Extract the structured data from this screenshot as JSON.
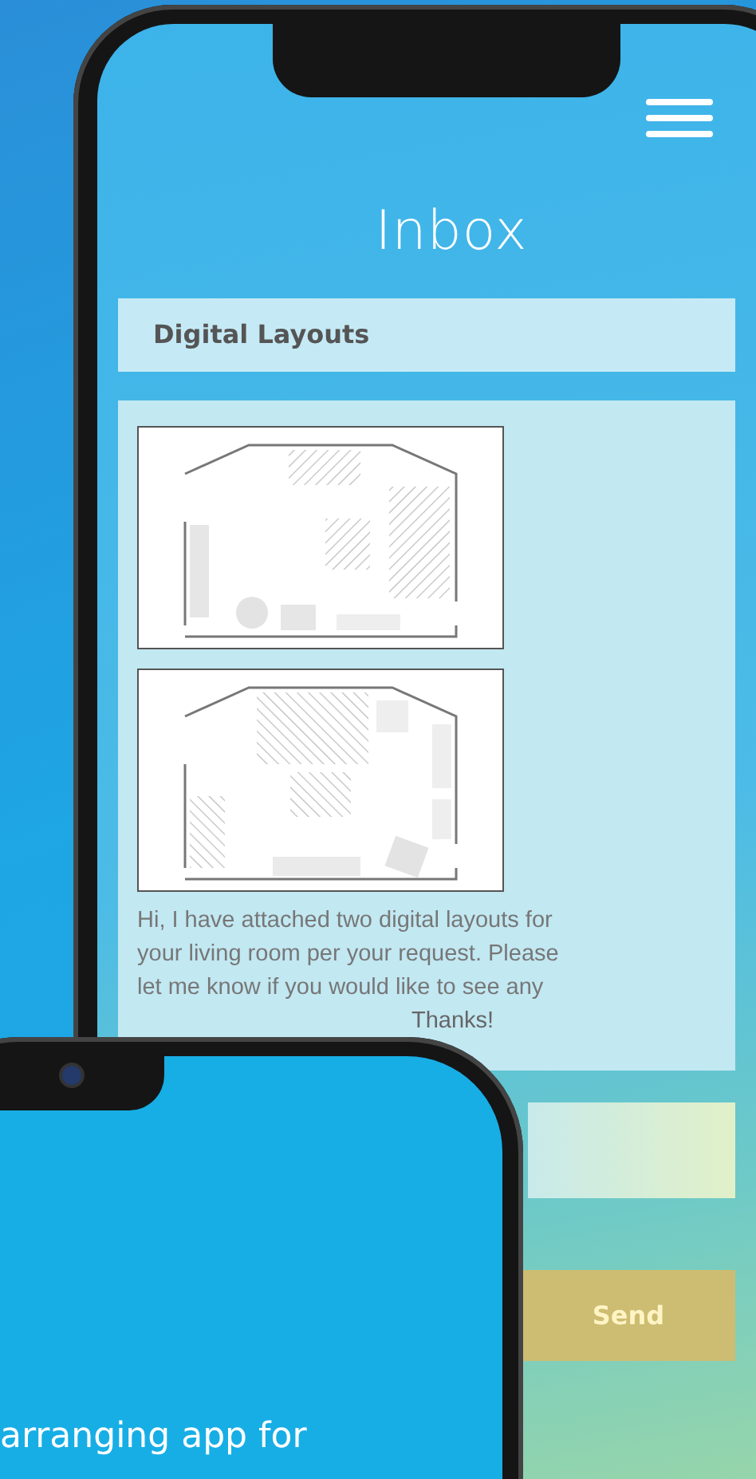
{
  "inbox": {
    "title": "Inbox",
    "subject": "Digital Layouts",
    "message_lines": [
      "Hi, I have attached two digital layouts for",
      "your living room per your request. Please",
      "let me know if you would like to see any"
    ],
    "message_tail": "Thanks!",
    "send_button": "Send"
  },
  "tagline": "arranging app for"
}
